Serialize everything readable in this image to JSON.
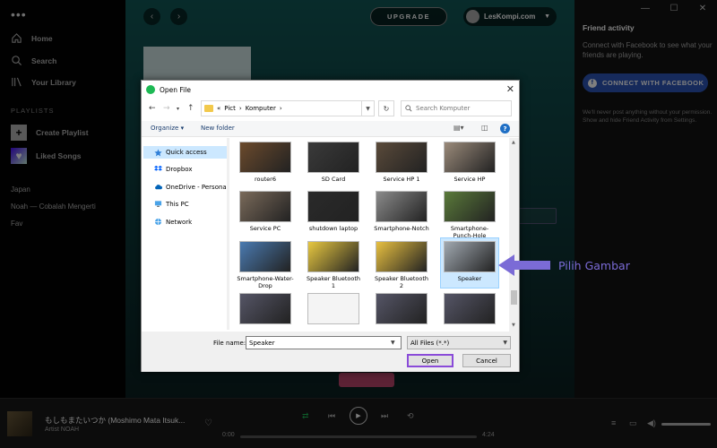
{
  "sidebar": {
    "nav": [
      {
        "label": "Home",
        "icon": "home-icon"
      },
      {
        "label": "Search",
        "icon": "search-icon"
      },
      {
        "label": "Your Library",
        "icon": "library-icon"
      }
    ],
    "playlists_title": "PLAYLISTS",
    "create_playlist": "Create Playlist",
    "liked_songs": "Liked Songs",
    "playlist_items": [
      "Japan",
      "Noah — Cobalah Mengerti",
      "Fav"
    ]
  },
  "header": {
    "upgrade": "UPGRADE",
    "user_name": "LesKompi.com"
  },
  "friends": {
    "title": "Friend activity",
    "description": "Connect with Facebook to see what your friends are playing.",
    "connect_button": "CONNECT WITH FACEBOOK",
    "note": "We'll never post anything without your permission. Show and hide Friend Activity from Settings."
  },
  "player": {
    "track_title": "もしもまたいつか (Moshimo Mata Itsuk...",
    "artist": "Artist NOAH",
    "time_start": "0:00",
    "time_end": "4:24",
    "progress": 0.0
  },
  "dialog": {
    "title": "Open File",
    "address": {
      "prefix": "«",
      "segments": [
        "Pict",
        "Komputer"
      ]
    },
    "search_placeholder": "Search Komputer",
    "organize": "Organize",
    "new_folder": "New folder",
    "nav_pane": [
      "Quick access",
      "Dropbox",
      "OneDrive - Personal",
      "This PC",
      "Network"
    ],
    "files": [
      {
        "name": "router6",
        "color": "#6b4a2c"
      },
      {
        "name": "SD Card",
        "color": "#3a3a3a"
      },
      {
        "name": "Service HP 1",
        "color": "#5a4a3a"
      },
      {
        "name": "Service HP",
        "color": "#9a8a7a"
      },
      {
        "name": "Service PC",
        "color": "#7a6a5a"
      },
      {
        "name": "shutdown laptop",
        "color": "#2a2a2a"
      },
      {
        "name": "Smartphone-Notch",
        "color": "#8a8a8a"
      },
      {
        "name": "Smartphone-Punch-Hole",
        "color": "#5a7a3a"
      },
      {
        "name": "Smartphone-Water-Drop",
        "color": "#4a7ab0"
      },
      {
        "name": "Speaker Bluetooth 1",
        "color": "#e8c840"
      },
      {
        "name": "Speaker Bluetooth 2",
        "color": "#e8c040"
      },
      {
        "name": "Speaker",
        "color": "#a0a8b0"
      }
    ],
    "file_name_label": "File name:",
    "file_name_value": "Speaker",
    "file_type": "All Files (*.*)",
    "open": "Open",
    "cancel": "Cancel"
  },
  "annotation": {
    "text": "Pilih Gambar",
    "color": "#7b6bd6"
  },
  "colors": {
    "spotify_green": "#1db954",
    "selection": "#cce8ff",
    "focus_outline": "#8a4bd9",
    "facebook_blue": "#2d55b7"
  }
}
